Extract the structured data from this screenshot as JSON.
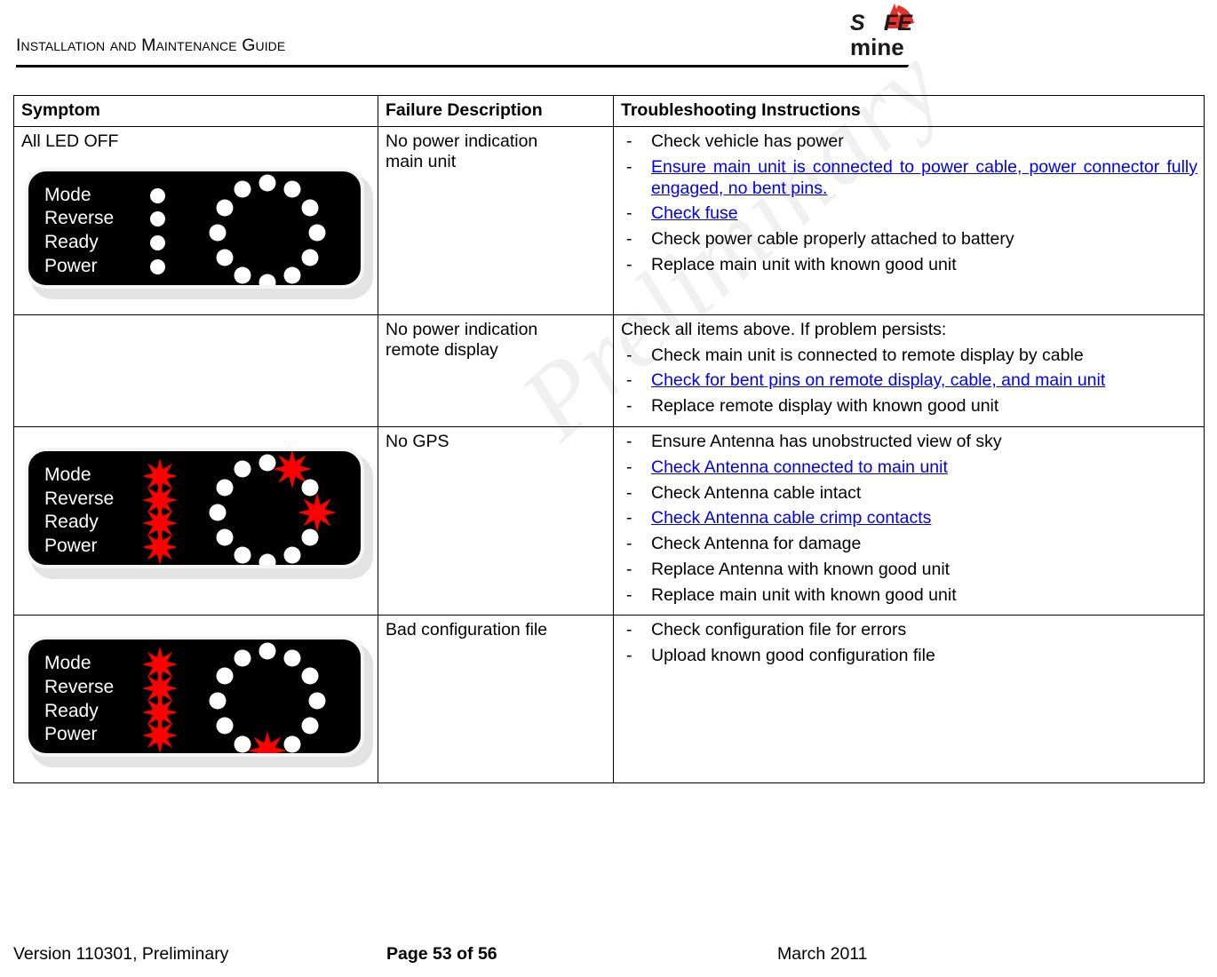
{
  "header": {
    "title": "Installation and Maintenance Guide",
    "logo": {
      "name": "safemine-logo",
      "line1": "SAFE",
      "line2": "mine",
      "accent_color": "#e8302a",
      "text_color": "#1a1a1a"
    }
  },
  "watermark": {
    "text": "Preliminary",
    "color": "#f0f0f0"
  },
  "table": {
    "columns": [
      "Symptom",
      "Failure Description",
      "Troubleshooting Instructions"
    ],
    "rows": [
      {
        "symptom_text": "All LED OFF",
        "device": {
          "labels": [
            "Mode",
            "Reverse",
            "Ready",
            "Power"
          ],
          "status_states": [
            "off",
            "off",
            "off",
            "off"
          ],
          "ring_count": 12,
          "ring_states": [
            "off",
            "off",
            "off",
            "off",
            "off",
            "off",
            "off",
            "off",
            "off",
            "off",
            "off",
            "off"
          ]
        },
        "failure": "No power indication\nmain unit",
        "lead_in": "",
        "steps": [
          {
            "text": "Check vehicle has power",
            "link": false,
            "justify": false
          },
          {
            "text": "Ensure main unit is connected to power cable, power connector fully engaged, no bent pins.",
            "link": true,
            "justify": true
          },
          {
            "text": "Check fuse",
            "link": true,
            "justify": false
          },
          {
            "text": "Check power cable properly attached to battery",
            "link": false,
            "justify": false
          },
          {
            "text": "Replace main unit with known good unit",
            "link": false,
            "justify": false
          }
        ]
      },
      {
        "symptom_text": "",
        "device": null,
        "failure": "No power indication\nremote display",
        "lead_in": "Check all items above. If problem persists:",
        "steps": [
          {
            "text": "Check main unit is connected to remote display by cable",
            "link": false,
            "justify": false
          },
          {
            "text": "Check for bent pins on remote display, cable, and main unit",
            "link": true,
            "justify": true
          },
          {
            "text": "Replace remote display with known good unit",
            "link": false,
            "justify": false
          }
        ]
      },
      {
        "symptom_text": "",
        "device": {
          "labels": [
            "Mode",
            "Reverse",
            "Ready",
            "Power"
          ],
          "status_states": [
            "red",
            "red",
            "red",
            "red"
          ],
          "ring_count": 12,
          "ring_states": [
            "off",
            "red",
            "off",
            "red",
            "off",
            "off",
            "off",
            "off",
            "off",
            "off",
            "off",
            "off"
          ]
        },
        "failure": "No GPS",
        "lead_in": "",
        "steps": [
          {
            "text": "Ensure Antenna has unobstructed view of sky",
            "link": false,
            "justify": false
          },
          {
            "text": "Check Antenna connected to main unit",
            "link": true,
            "justify": false
          },
          {
            "text": "Check Antenna cable intact",
            "link": false,
            "justify": false
          },
          {
            "text": "Check Antenna cable crimp contacts",
            "link": true,
            "justify": false
          },
          {
            "text": "Check Antenna for damage",
            "link": false,
            "justify": false
          },
          {
            "text": "Replace Antenna with known good unit",
            "link": false,
            "justify": false
          },
          {
            "text": "Replace main unit with known good unit",
            "link": false,
            "justify": false
          }
        ]
      },
      {
        "symptom_text": "",
        "device": {
          "labels": [
            "Mode",
            "Reverse",
            "Ready",
            "Power"
          ],
          "status_states": [
            "red",
            "red",
            "red",
            "red"
          ],
          "ring_count": 12,
          "ring_states": [
            "off",
            "off",
            "off",
            "off",
            "off",
            "off",
            "red",
            "off",
            "off",
            "off",
            "off",
            "off"
          ]
        },
        "failure": "Bad configuration file",
        "lead_in": "",
        "steps": [
          {
            "text": "Check configuration file for errors",
            "link": false,
            "justify": false
          },
          {
            "text": "Upload known good configuration file",
            "link": false,
            "justify": false
          }
        ]
      }
    ],
    "bullet_dash": "-"
  },
  "footer": {
    "version": "Version 110301, Preliminary",
    "page": "Page 53 of 56",
    "date": "March 2011"
  }
}
